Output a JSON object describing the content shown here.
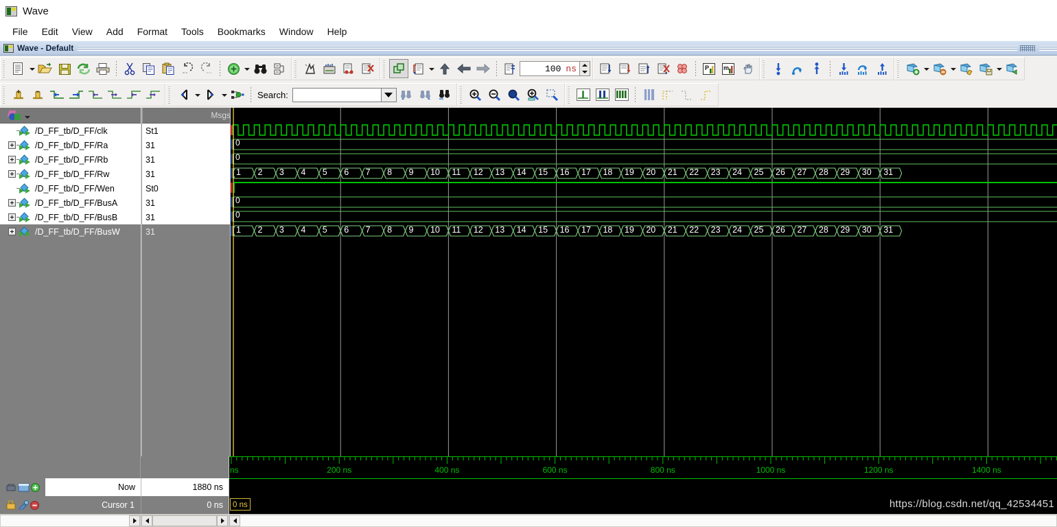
{
  "window": {
    "title": "Wave",
    "icon": "modelsim-wave-icon"
  },
  "menubar": [
    {
      "label": "File"
    },
    {
      "label": "Edit"
    },
    {
      "label": "View"
    },
    {
      "label": "Add"
    },
    {
      "label": "Format"
    },
    {
      "label": "Tools"
    },
    {
      "label": "Bookmarks"
    },
    {
      "label": "Window"
    },
    {
      "label": "Help"
    }
  ],
  "pane": {
    "title": "Wave - Default",
    "icon": "wave-pane-icon"
  },
  "toolbar_row1": {
    "group1": [
      {
        "icon": "new-document-icon"
      },
      {
        "icon": "dropdown-caret"
      },
      {
        "icon": "open-folder-icon"
      },
      {
        "icon": "save-disk-icon"
      },
      {
        "icon": "reload-icon"
      },
      {
        "icon": "print-icon"
      },
      {
        "icon": "separator"
      },
      {
        "icon": "cut-scissors-icon"
      },
      {
        "icon": "copy-icon"
      },
      {
        "icon": "paste-icon"
      },
      {
        "icon": "undo-icon"
      },
      {
        "icon": "redo-icon"
      },
      {
        "icon": "separator"
      },
      {
        "icon": "add-green-plus-icon"
      },
      {
        "icon": "dropdown-caret"
      },
      {
        "icon": "find-binoculars-icon"
      },
      {
        "icon": "properties-icon"
      }
    ],
    "group2": [
      {
        "icon": "simulate-icon"
      },
      {
        "icon": "restart-icon"
      },
      {
        "icon": "break-icon"
      },
      {
        "icon": "stop-icon"
      }
    ],
    "group3": [
      {
        "icon": "compile-icon",
        "pressed": true
      },
      {
        "icon": "compile-order-icon"
      },
      {
        "icon": "dropdown-caret"
      },
      {
        "icon": "step-up-arrow-icon"
      },
      {
        "icon": "step-back-arrow-icon"
      },
      {
        "icon": "step-forward-arrow-icon"
      },
      {
        "icon": "separator"
      },
      {
        "icon": "run-length-icon"
      }
    ],
    "run_length": {
      "value": "100",
      "unit": "ns",
      "spinner": "run-length-spinner"
    },
    "group4": [
      {
        "icon": "run-icon"
      },
      {
        "icon": "run-continue-icon"
      },
      {
        "icon": "run-all-icon"
      },
      {
        "icon": "restart-sim-icon"
      },
      {
        "icon": "break-sim-icon"
      },
      {
        "icon": "separator"
      },
      {
        "icon": "profile-p-icon"
      },
      {
        "icon": "memory-m-icon"
      },
      {
        "icon": "hand-pan-icon"
      }
    ],
    "group5": [
      {
        "icon": "insert-down-icon"
      },
      {
        "icon": "loop-arrow-icon"
      },
      {
        "icon": "insert-up-icon"
      },
      {
        "icon": "separator"
      },
      {
        "icon": "group-down-icon"
      },
      {
        "icon": "group-loop-icon"
      },
      {
        "icon": "group-up-icon"
      }
    ],
    "group6": [
      {
        "icon": "bookmark-add-icon"
      },
      {
        "icon": "dropdown-caret"
      },
      {
        "icon": "bookmark-remove-icon"
      },
      {
        "icon": "dropdown-caret"
      },
      {
        "icon": "bookmark-edit-icon"
      },
      {
        "icon": "bookmark-save-icon"
      },
      {
        "icon": "dropdown-caret"
      },
      {
        "icon": "bookmark-goto-icon"
      }
    ]
  },
  "toolbar_row2": {
    "group1": [
      {
        "icon": "cursor-add-icon"
      },
      {
        "icon": "cursor-delete-icon"
      },
      {
        "icon": "edge-prev-icon"
      },
      {
        "icon": "edge-next-icon"
      },
      {
        "icon": "falling-edge-prev-icon"
      },
      {
        "icon": "falling-edge-next-icon"
      },
      {
        "icon": "rising-edge-prev-icon"
      },
      {
        "icon": "rising-edge-next-icon"
      }
    ],
    "group2": [
      {
        "icon": "expand-left-icon"
      },
      {
        "icon": "dropdown-caret"
      },
      {
        "icon": "collapse-right-icon"
      },
      {
        "icon": "dropdown-caret"
      },
      {
        "icon": "expand-node-icon"
      },
      {
        "icon": "separator"
      }
    ],
    "search": {
      "label": "Search:",
      "value": "",
      "placeholder": "",
      "dropdown": "search-dropdown",
      "buttons": [
        {
          "icon": "search-prev-icon"
        },
        {
          "icon": "search-next-icon"
        },
        {
          "icon": "search-options-icon"
        }
      ]
    },
    "group3": [
      {
        "icon": "zoom-in-icon"
      },
      {
        "icon": "zoom-out-icon"
      },
      {
        "icon": "zoom-full-icon"
      },
      {
        "icon": "zoom-cursor-icon"
      },
      {
        "icon": "zoom-range-icon"
      }
    ],
    "group4": [
      {
        "icon": "wave-single-icon"
      },
      {
        "icon": "wave-pair-icon"
      },
      {
        "icon": "wave-all-icon"
      },
      {
        "icon": "separator"
      },
      {
        "icon": "mosaic-icon"
      },
      {
        "icon": "mosaic-edge-icon"
      },
      {
        "icon": "dotted-low-icon"
      },
      {
        "icon": "dotted-high-icon"
      }
    ]
  },
  "wave_panel": {
    "objects_header_icon": "objects-cube-icon",
    "values_header": "Msgs",
    "signals": [
      {
        "name": "/D_FF_tb/D_FF/clk",
        "value": "St1",
        "expandable": false,
        "selected": true,
        "kind": "clock"
      },
      {
        "name": "/D_FF_tb/D_FF/Ra",
        "value": "31",
        "expandable": true,
        "selected": true,
        "kind": "const0"
      },
      {
        "name": "/D_FF_tb/D_FF/Rb",
        "value": "31",
        "expandable": true,
        "selected": true,
        "kind": "const0"
      },
      {
        "name": "/D_FF_tb/D_FF/Rw",
        "value": "31",
        "expandable": true,
        "selected": true,
        "kind": "bus"
      },
      {
        "name": "/D_FF_tb/D_FF/Wen",
        "value": "St0",
        "expandable": false,
        "selected": true,
        "kind": "high"
      },
      {
        "name": "/D_FF_tb/D_FF/BusA",
        "value": "31",
        "expandable": true,
        "selected": true,
        "kind": "const0"
      },
      {
        "name": "/D_FF_tb/D_FF/BusB",
        "value": "31",
        "expandable": true,
        "selected": true,
        "kind": "const0"
      },
      {
        "name": "/D_FF_tb/D_FF/BusW",
        "value": "31",
        "expandable": true,
        "selected": false,
        "kind": "bus"
      }
    ],
    "bus_values": [
      "1",
      "2",
      "3",
      "4",
      "5",
      "6",
      "7",
      "8",
      "9",
      "10",
      "11",
      "12",
      "13",
      "14",
      "15",
      "16",
      "17",
      "18",
      "19",
      "20",
      "21",
      "22",
      "23",
      "24",
      "25",
      "26",
      "27",
      "28",
      "29",
      "30",
      "31"
    ],
    "const_value": "0",
    "ruler": {
      "unit_label": "ns",
      "ticks": [
        "200 ns",
        "400 ns",
        "600 ns",
        "800 ns",
        "1000 ns",
        "1200 ns",
        "1400 ns"
      ],
      "tick_times": [
        200,
        400,
        600,
        800,
        1000,
        1200,
        1400
      ],
      "range_start_ns": 0,
      "range_end_ns": 1600
    },
    "status": {
      "now_label": "Now",
      "now_value": "1880 ns",
      "cursor_label": "Cursor 1",
      "cursor_value": "0 ns",
      "cursor_flag": "0 ns",
      "now_icons": [
        "now-lock-icon",
        "now-pane-icon",
        "now-add-icon"
      ],
      "cursor_icons": [
        "cursor-lock-icon",
        "cursor-tool-icon",
        "cursor-delete-icon"
      ]
    }
  },
  "colors": {
    "wave_bg": "#000000",
    "wave_green": "#00d800",
    "wave_grid": "#c0c8c0",
    "bus_text": "#ffffff",
    "ruler_green": "#00c000",
    "cursor_yellow": "#e8c840",
    "red_marker": "#d02020",
    "panel_gray": "#808080",
    "toolbar_gray": "#f1f0ee"
  },
  "watermark": "https://blog.csdn.net/qq_42534451"
}
